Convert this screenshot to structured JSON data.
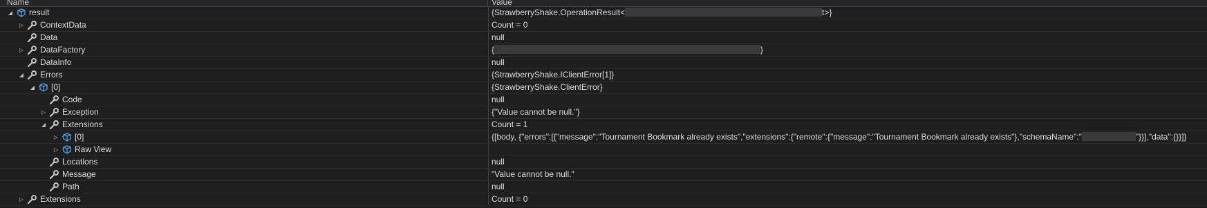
{
  "header": {
    "name": "Name",
    "value": "Value"
  },
  "rows": [
    {
      "label": "result",
      "value_pre": "{StrawberryShake.OperationResult<",
      "value_post": "t>}"
    },
    {
      "label": "ContextData",
      "value": "Count = 0"
    },
    {
      "label": "Data",
      "value": "null"
    },
    {
      "label": "DataFactory",
      "value_pre": "{",
      "value_post": "}"
    },
    {
      "label": "DataInfo",
      "value": "null"
    },
    {
      "label": "Errors",
      "value": "{StrawberryShake.IClientError[1]}"
    },
    {
      "label": "[0]",
      "value": "{StrawberryShake.ClientError}"
    },
    {
      "label": "Code",
      "value": "null"
    },
    {
      "label": "Exception",
      "value": "{\"Value cannot be null.\"}"
    },
    {
      "label": "Extensions",
      "value": "Count = 1"
    },
    {
      "label": "[0]",
      "value_pre": "{[body, {\"errors\":[{\"message\":\"Tournament Bookmark already exists\",\"extensions\":{\"remote\":{\"message\":\"Tournament Bookmark already exists\"},\"schemaName\":\"",
      "value_post": "\"}}],\"data\":{}}]}"
    },
    {
      "label": "Raw View",
      "value": ""
    },
    {
      "label": "Locations",
      "value": "null"
    },
    {
      "label": "Message",
      "value": "\"Value cannot be null.\""
    },
    {
      "label": "Path",
      "value": "null"
    },
    {
      "label": "Extensions",
      "value": "Count = 0"
    }
  ],
  "colors": {
    "background": "#1e1e1e",
    "text": "#dcdcdc",
    "wrench": "#c8c8c8",
    "object_icon": "#4ea0e6",
    "redaction": "#3a3a3a"
  },
  "icons": {
    "wrench": "wrench-icon",
    "object": "object-cube-icon",
    "expand": "triangle-right-icon",
    "expanded": "triangle-down-icon"
  }
}
